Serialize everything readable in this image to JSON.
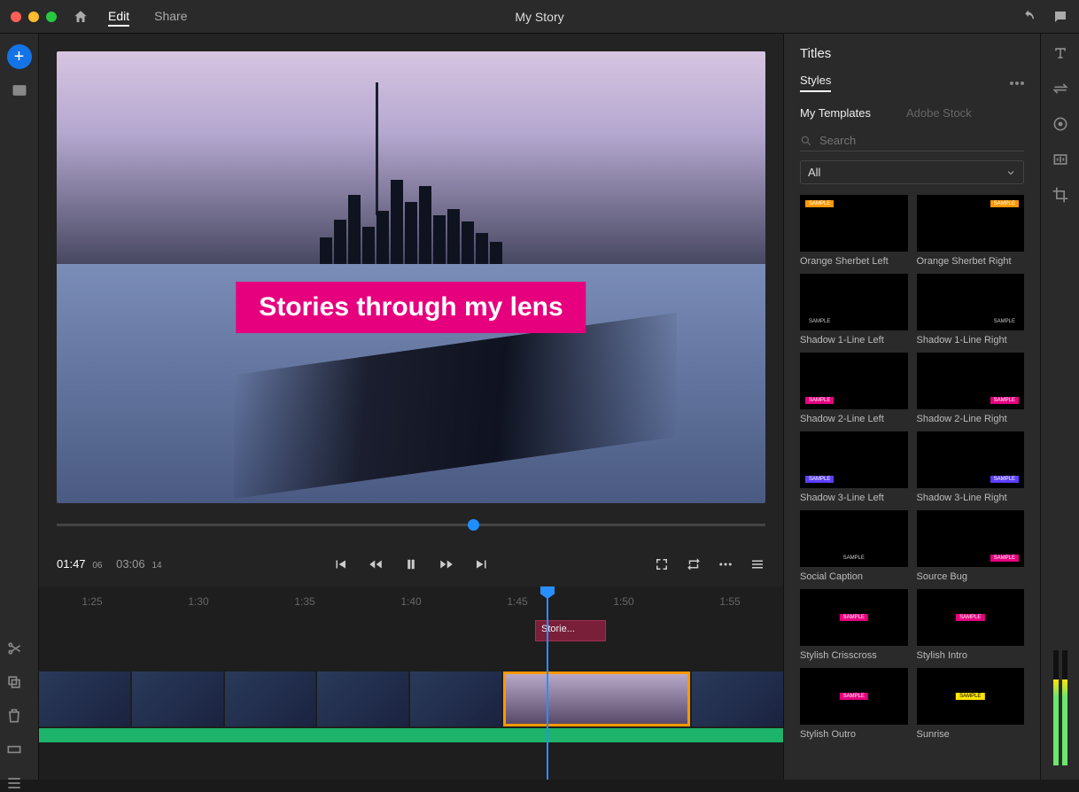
{
  "titlebar": {
    "edit": "Edit",
    "share": "Share",
    "doc_title": "My Story"
  },
  "preview": {
    "overlay_text": "Stories through my lens"
  },
  "controls": {
    "current": "01:47",
    "current_frames": "06",
    "total": "03:06",
    "total_frames": "14"
  },
  "ruler": [
    "1:25",
    "1:30",
    "1:35",
    "1:40",
    "1:45",
    "1:50",
    "1:55"
  ],
  "title_clip": "Storie...",
  "right_panel": {
    "header": "Titles",
    "sub": "Styles",
    "tab_my": "My Templates",
    "tab_stock": "Adobe Stock",
    "search_placeholder": "Search",
    "filter": "All"
  },
  "templates": [
    {
      "name": "Orange Sherbet Left",
      "style": "o",
      "pos": "tl"
    },
    {
      "name": "Orange Sherbet Right",
      "style": "o",
      "pos": "tr"
    },
    {
      "name": "Shadow 1-Line Left",
      "style": "w",
      "pos": "bl"
    },
    {
      "name": "Shadow 1-Line Right",
      "style": "w",
      "pos": "br"
    },
    {
      "name": "Shadow 2-Line Left",
      "style": "p",
      "pos": "bl"
    },
    {
      "name": "Shadow 2-Line Right",
      "style": "p",
      "pos": "br"
    },
    {
      "name": "Shadow 3-Line Left",
      "style": "b",
      "pos": "bl"
    },
    {
      "name": "Shadow 3-Line Right",
      "style": "b",
      "pos": "br"
    },
    {
      "name": "Social Caption",
      "style": "w",
      "pos": "bc"
    },
    {
      "name": "Source Bug",
      "style": "p",
      "pos": "br"
    },
    {
      "name": "Stylish Crisscross",
      "style": "p",
      "pos": "c"
    },
    {
      "name": "Stylish Intro",
      "style": "p",
      "pos": "c"
    },
    {
      "name": "Stylish Outro",
      "style": "p",
      "pos": "c"
    },
    {
      "name": "Sunrise",
      "style": "y",
      "pos": "c"
    }
  ]
}
